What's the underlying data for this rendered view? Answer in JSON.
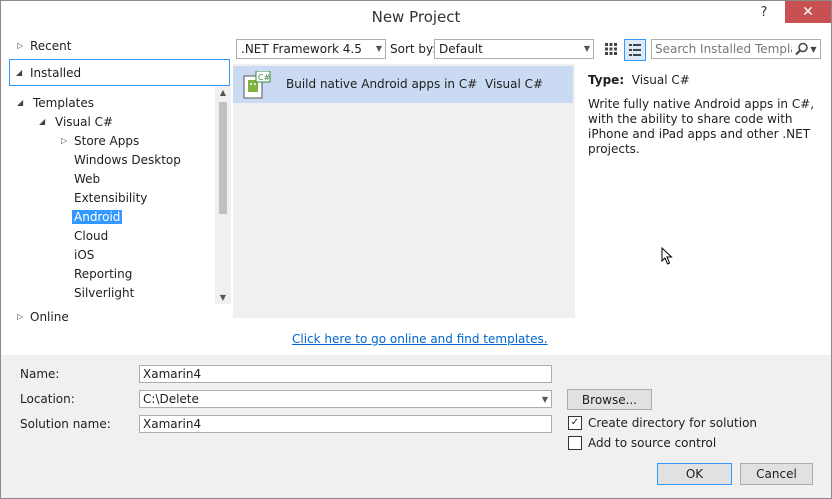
{
  "window": {
    "title": "New Project",
    "help": "?",
    "close": "✕"
  },
  "tree": {
    "recent": "Recent",
    "installed": "Installed",
    "templates": "Templates",
    "visual_csharp": "Visual C#",
    "children": [
      "Store Apps",
      "Windows Desktop",
      "Web",
      "Extensibility",
      "Android",
      "Cloud",
      "iOS",
      "Reporting",
      "Silverlight"
    ],
    "selected": "Android",
    "online": "Online"
  },
  "toolbar": {
    "framework": ".NET Framework 4.5",
    "sort_label": "Sort by:",
    "sort_value": "Default",
    "search_placeholder": "Search Installed Templates"
  },
  "templates": [
    {
      "name": "Build native Android apps in C#",
      "language": "Visual C#"
    }
  ],
  "info": {
    "type_label": "Type:",
    "type_value": "Visual C#",
    "description": "Write fully native Android apps in C#, with the ability to share code with iPhone and iPad apps and other .NET projects."
  },
  "online_link": "Click here to go online and find templates.",
  "form": {
    "name_label": "Name:",
    "name_value": "Xamarin4",
    "location_label": "Location:",
    "location_value": "C:\\Delete",
    "solution_label": "Solution name:",
    "solution_value": "Xamarin4",
    "browse": "Browse...",
    "create_dir": "Create directory for solution",
    "create_dir_checked": true,
    "source_control": "Add to source control",
    "source_control_checked": false,
    "ok": "OK",
    "cancel": "Cancel"
  }
}
